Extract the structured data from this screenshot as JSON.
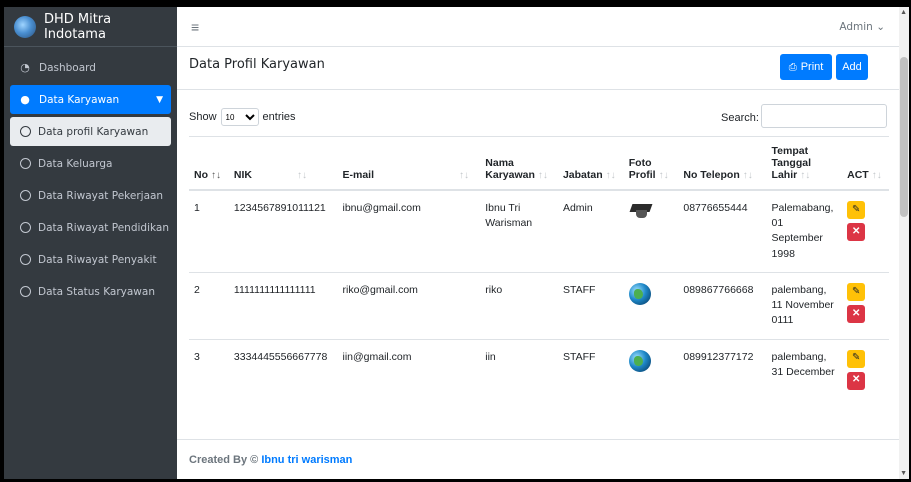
{
  "brand": {
    "title": "DHD Mitra Indotama"
  },
  "topbar": {
    "menu_icon": "≡",
    "user": "Admin"
  },
  "sidebar": {
    "items": [
      {
        "label": "Dashboard"
      },
      {
        "label": "Data Karyawan"
      },
      {
        "label": "Data profil Karyawan"
      },
      {
        "label": "Data Keluarga"
      },
      {
        "label": "Data Riwayat Pekerjaan"
      },
      {
        "label": "Data Riwayat Pendidikan"
      },
      {
        "label": "Data Riwayat Penyakit"
      },
      {
        "label": "Data Status Karyawan"
      }
    ]
  },
  "main": {
    "title": "Data Profil Karyawan",
    "print_label": "Print",
    "add_label": "Add",
    "show_label": "Show",
    "entries_value": "10",
    "entries_label": "entries",
    "search_label": "Search:",
    "columns": [
      "No",
      "NIK",
      "E-mail",
      "Nama Karyawan",
      "Jabatan",
      "Foto Profil",
      "No Telepon",
      "Tempat Tanggal Lahir",
      "ACT"
    ],
    "rows": [
      {
        "no": "1",
        "nik": "1234567891011121",
        "email": "ibnu@gmail.com",
        "nama": "Ibnu Tri Warisman",
        "jabatan": "Admin",
        "foto": "graduation-cap",
        "telepon": "08776655444",
        "ttl": "Palemabang, 01 September 1998"
      },
      {
        "no": "2",
        "nik": "1111111111111111",
        "email": "riko@gmail.com",
        "nama": "riko",
        "jabatan": "STAFF",
        "foto": "globe",
        "telepon": "089867766668",
        "ttl": "palembang, 11 November 0111"
      },
      {
        "no": "3",
        "nik": "3334445556667778",
        "email": "iin@gmail.com",
        "nama": "iin",
        "jabatan": "STAFF",
        "foto": "globe",
        "telepon": "089912377172",
        "ttl": "palembang, 31 December"
      }
    ]
  },
  "footer": {
    "prefix": "Created By ©",
    "author": "Ibnu tri warisman"
  },
  "colors": {
    "primary": "#007bff",
    "sidebar_bg": "#343a40",
    "warning": "#ffc107",
    "danger": "#dc3545"
  }
}
